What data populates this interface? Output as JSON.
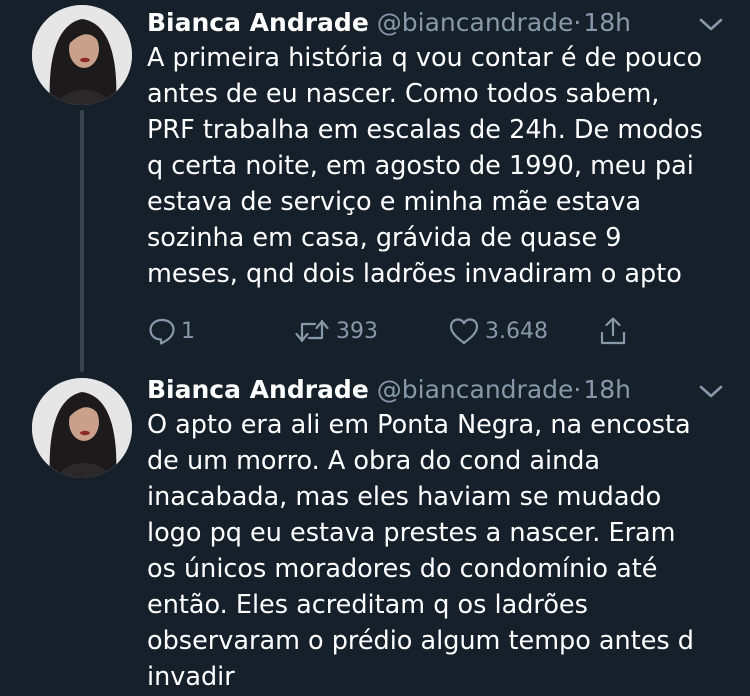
{
  "tweets": [
    {
      "author_name": "Bianca Andrade",
      "author_handle": "@biancandrade",
      "separator": "·",
      "time": "18h",
      "text": "A primeira história q vou contar é de pouco\nantes de eu nascer. Como todos sabem,\nPRF trabalha em escalas de 24h. De modos\nq certa noite, em agosto de 1990, meu pai\nestava de serviço e minha mãe estava\nsozinha em casa, grávida de quase 9\nmeses, qnd dois ladrões invadiram o apto",
      "reply_count": "1",
      "retweet_count": "393",
      "like_count": "3.648",
      "icons": [
        "reply-icon",
        "retweet-icon",
        "like-icon",
        "share-icon",
        "chevron-down-icon"
      ]
    },
    {
      "author_name": "Bianca Andrade",
      "author_handle": "@biancandrade",
      "separator": "·",
      "time": "18h",
      "text": "O apto era ali em Ponta Negra, na encosta\nde um morro. A obra do cond  ainda\ninacabada, mas eles haviam se mudado\nlogo pq eu estava prestes a nascer. Eram\nos únicos moradores do condomínio até\nentão. Eles acreditam q os ladrões\nobservaram o prédio algum tempo antes d\ninvadir",
      "icons": [
        "chevron-down-icon"
      ]
    }
  ],
  "colors": {
    "background": "#15202b",
    "text_primary": "#ffffff",
    "text_secondary": "#8899a6",
    "thread_line": "#38444d"
  }
}
